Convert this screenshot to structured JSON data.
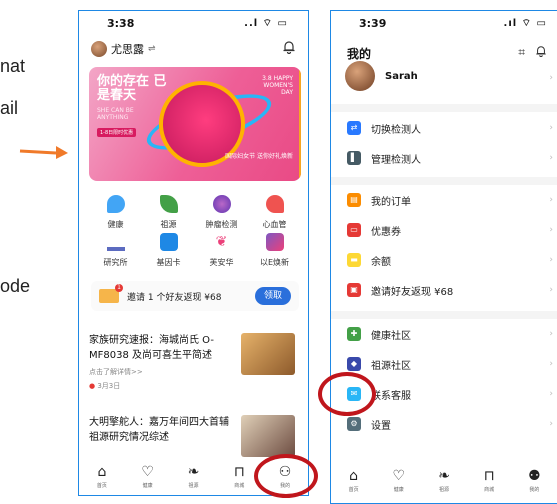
{
  "left_text": {
    "l1": "nat",
    "l2": "ail",
    "l3": "ode"
  },
  "left_phone": {
    "status": {
      "time": "3:38",
      "signal": "..l ⌔ ▭"
    },
    "user_name": "尤思露",
    "banner": {
      "headline": "你的存在 已是春天",
      "sub": "SHE CAN BE ANYTHING",
      "tag": "1-8日限时优惠",
      "right_top": "3.8 HAPPY WOMEN'S DAY",
      "right_bottom": "国际妇女节 送你好礼焕新"
    },
    "grid_row1": [
      "健康",
      "祖源",
      "肿瘤检测",
      "心血管"
    ],
    "grid_row2": [
      "研究所",
      "基因卡",
      "芙安华",
      "以E焕新"
    ],
    "grid_colors1": [
      "#42a5f5",
      "#43a047",
      "#7e57c2",
      "#ef5350"
    ],
    "grid_colors2": [
      "#5c6bc0",
      "#1e88e5",
      "#ec407a",
      "#ab47bc"
    ],
    "invite": {
      "text": "邀请 1 个好友返现 ¥68",
      "button": "领取",
      "badge": "1"
    },
    "article1": {
      "title": "家族研究速报：海城尚氏 O-MF8038 及尚可喜生平简述",
      "sub": "点击了解详情>>",
      "date": "3月3日"
    },
    "article2": {
      "title": "大明擎舵人：嘉万年间四大首辅祖源研究情况综述"
    },
    "tabs": [
      "首页",
      "健康",
      "祖源",
      "商城",
      "我的"
    ]
  },
  "right_phone": {
    "status": {
      "time": "3:39",
      "signal": ".ıl ⌔ ▭"
    },
    "title": "我的",
    "profile_name": "Sarah",
    "rows": [
      {
        "label": "切换检测人",
        "icon": "⇄",
        "color": "#2979ff"
      },
      {
        "label": "管理检测人",
        "icon": "▌",
        "color": "#455a64"
      },
      {
        "label": "我的订单",
        "icon": "▤",
        "color": "#fb8c00"
      },
      {
        "label": "优惠券",
        "icon": "▭",
        "color": "#e53935"
      },
      {
        "label": "余额",
        "icon": "▬",
        "color": "#fdd835"
      },
      {
        "label": "邀请好友返现 ¥68",
        "icon": "▣",
        "color": "#e53935"
      },
      {
        "label": "健康社区",
        "icon": "✚",
        "color": "#43a047"
      },
      {
        "label": "祖源社区",
        "icon": "◆",
        "color": "#3949ab"
      },
      {
        "label": "联系客服",
        "icon": "✉",
        "color": "#29b6f6"
      },
      {
        "label": "设置",
        "icon": "⚙",
        "color": "#546e7a"
      }
    ],
    "tabs": [
      "首页",
      "健康",
      "祖源",
      "商城",
      "我的"
    ]
  }
}
